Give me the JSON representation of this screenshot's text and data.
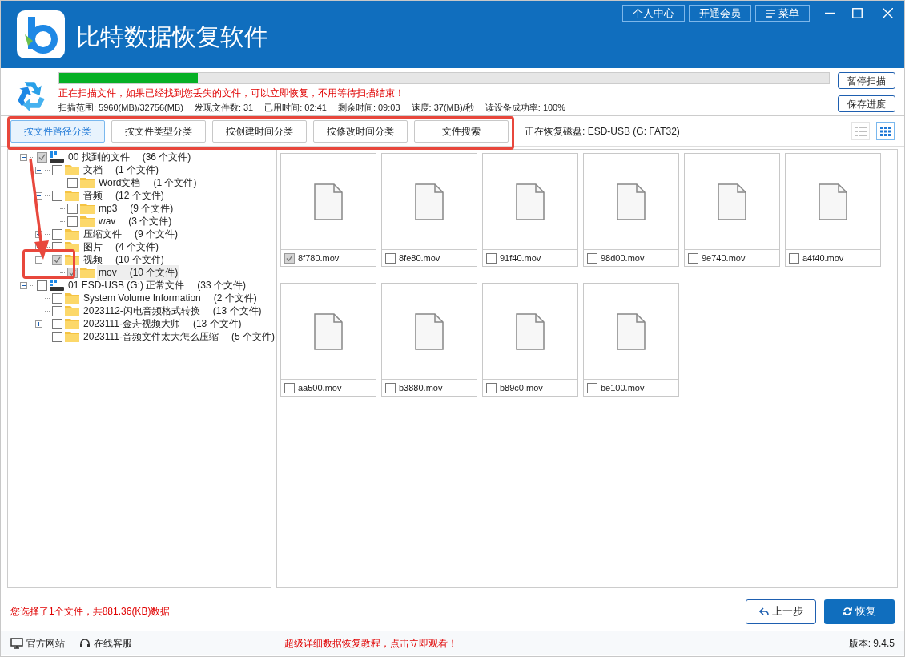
{
  "window": {
    "title": "比特数据恢复软件",
    "buttons": [
      "个人中心",
      "开通会员",
      "菜单"
    ]
  },
  "scan": {
    "level": 0.18,
    "message": "正在扫描文件，如果已经找到您丢失的文件，可以立即恢复，不用等待扫描结束！",
    "stats": [
      "扫描范围: 5960(MB)/32756(MB)",
      "发现文件数: 31",
      "已用时间: 02:41",
      "剩余时间: 09:03",
      "速度: 37(MB)/秒",
      "读设备成功率: 100%"
    ],
    "buttons": [
      "暂停扫描",
      "保存进度"
    ]
  },
  "tabs": [
    {
      "label": "按文件路径分类",
      "selected": true
    },
    {
      "label": "按文件类型分类",
      "selected": false
    },
    {
      "label": "按创建时间分类",
      "selected": false
    },
    {
      "label": "按修改时间分类",
      "selected": false
    },
    {
      "label": "文件搜索",
      "selected": false
    }
  ],
  "disk": "正在恢复磁盘: ESD-USB (G: FAT32)",
  "view_modes": [
    {
      "kind": "list",
      "selected": false
    },
    {
      "kind": "grid",
      "selected": true
    }
  ],
  "tree": [
    {
      "kind": "drive",
      "label": "00 找到的文件",
      "count": "(36 个文件)",
      "checked": true,
      "selected": false,
      "expanded": true,
      "children": [
        {
          "kind": "folder",
          "label": "文档",
          "count": "(1 个文件)",
          "checked": false,
          "selected": false,
          "expanded": true,
          "children": [
            {
              "kind": "folder",
              "label": "Word文档",
              "count": "(1 个文件)",
              "checked": false,
              "selected": false
            }
          ]
        },
        {
          "kind": "folder",
          "label": "音频",
          "count": "(12 个文件)",
          "checked": false,
          "selected": false,
          "expanded": true,
          "children": [
            {
              "kind": "folder",
              "label": "mp3",
              "count": "(9 个文件)",
              "checked": false,
              "selected": false
            },
            {
              "kind": "folder",
              "label": "wav",
              "count": "(3 个文件)",
              "checked": false,
              "selected": false
            }
          ]
        },
        {
          "kind": "folder",
          "label": "压缩文件",
          "count": "(9 个文件)",
          "checked": false,
          "selected": false,
          "expanded": false
        },
        {
          "kind": "folder",
          "label": "图片",
          "count": "(4 个文件)",
          "checked": false,
          "selected": false,
          "expanded": false
        },
        {
          "kind": "folder",
          "label": "视频",
          "count": "(10 个文件)",
          "checked": true,
          "selected": false,
          "expanded": true,
          "children": [
            {
              "kind": "folder",
              "label": "mov",
              "count": "(10 个文件)",
              "checked": true,
              "selected": true
            }
          ]
        }
      ]
    },
    {
      "kind": "drive",
      "label": "01 ESD-USB (G:) 正常文件",
      "count": "(33 个文件)",
      "checked": false,
      "selected": false,
      "expanded": true,
      "children": [
        {
          "kind": "folder",
          "label": "System Volume Information",
          "count": "(2 个文件)",
          "checked": false,
          "selected": false
        },
        {
          "kind": "folder",
          "label": "2023112-闪电音频格式转换",
          "count": "(13 个文件)",
          "checked": false,
          "selected": false
        },
        {
          "kind": "folder",
          "label": "2023111-金舟视频大师",
          "count": "(13 个文件)",
          "checked": false,
          "selected": false,
          "expanded": false
        },
        {
          "kind": "folder",
          "label": "2023111-音频文件太大怎么压缩",
          "count": "(5 个文件)",
          "checked": false,
          "selected": false
        }
      ]
    }
  ],
  "files": [
    {
      "name": "8f780.mov",
      "checked": true
    },
    {
      "name": "8fe80.mov",
      "checked": false
    },
    {
      "name": "91f40.mov",
      "checked": false
    },
    {
      "name": "98d00.mov",
      "checked": false
    },
    {
      "name": "9e740.mov",
      "checked": false
    },
    {
      "name": "a4f40.mov",
      "checked": false
    },
    {
      "name": "aa500.mov",
      "checked": false
    },
    {
      "name": "b3880.mov",
      "checked": false
    },
    {
      "name": "b89c0.mov",
      "checked": false
    },
    {
      "name": "be100.mov",
      "checked": false
    }
  ],
  "selection_summary": "您选择了1个文件，共881.36(KB)数据",
  "actions": [
    "上一步",
    "恢复"
  ],
  "footer": {
    "links": [
      "官方网站",
      "在线客服"
    ],
    "promo": "超级详细数据恢复教程，点击立即观看！",
    "version": "版本: 9.4.5"
  }
}
